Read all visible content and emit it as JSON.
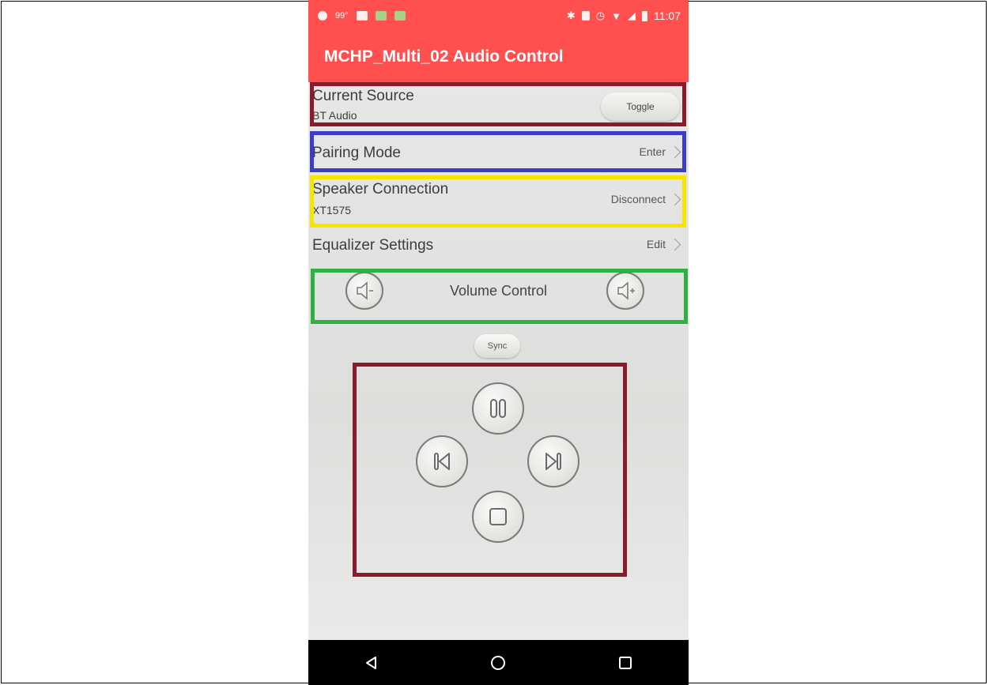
{
  "status_bar": {
    "temperature": "99°",
    "time": "11:07",
    "icons": [
      "app-icon",
      "temperature-text",
      "image-icon",
      "book-icon",
      "book-icon",
      "bluetooth-icon",
      "vibrate-icon",
      "alarm-icon",
      "wifi-icon",
      "signal-icon",
      "battery-icon"
    ]
  },
  "app_bar": {
    "title": "MCHP_Multi_02 Audio Control"
  },
  "rows": {
    "current_source": {
      "label": "Current Source",
      "value": "BT Audio",
      "action": "Toggle"
    },
    "pairing_mode": {
      "label": "Pairing Mode",
      "action": "Enter"
    },
    "speaker_connection": {
      "label": "Speaker Connection",
      "value": "XT1575",
      "action": "Disconnect"
    },
    "equalizer": {
      "label": "Equalizer Settings",
      "action": "Edit"
    }
  },
  "volume": {
    "label": "Volume Control",
    "icons": [
      "volume-down-icon",
      "volume-up-icon"
    ]
  },
  "sync": {
    "label": "Sync"
  },
  "playback": {
    "icons": [
      "pause-icon",
      "previous-icon",
      "next-icon",
      "stop-icon"
    ]
  },
  "nav_bar": {
    "icons": [
      "back-icon",
      "home-icon",
      "recents-icon"
    ]
  },
  "colors": {
    "app_bar": "#ff4f4f",
    "highlight_red": "#8b1a2b",
    "highlight_blue": "#3c3cc8",
    "highlight_yellow": "#f5e600",
    "highlight_green": "#2fb040",
    "nav_bar": "#000000"
  }
}
